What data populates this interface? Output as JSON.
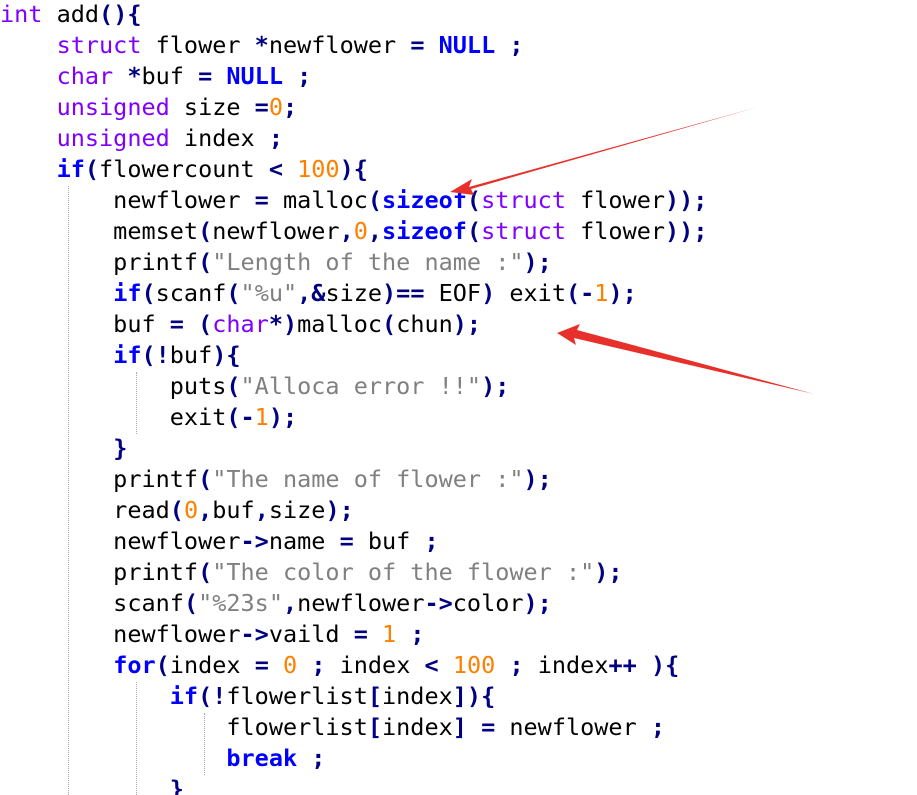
{
  "colors": {
    "plain": "#000000",
    "keyword": "#0000ff",
    "type": "#8000ff",
    "number": "#ff8000",
    "string": "#808080",
    "operator": "#000080",
    "annotation_arrow": "#e8302a",
    "guide": "#a8a8a8"
  },
  "code": {
    "lines": [
      [
        [
          "t",
          "int"
        ],
        [
          "p",
          " add"
        ],
        [
          "o",
          "(){"
        ]
      ],
      [
        [
          "p",
          "    "
        ],
        [
          "t",
          "struct"
        ],
        [
          "p",
          " flower "
        ],
        [
          "o",
          "*"
        ],
        [
          "p",
          "newflower "
        ],
        [
          "o",
          "="
        ],
        [
          "p",
          " "
        ],
        [
          "k",
          "NULL"
        ],
        [
          "p",
          " "
        ],
        [
          "o",
          ";"
        ]
      ],
      [
        [
          "p",
          "    "
        ],
        [
          "t",
          "char"
        ],
        [
          "p",
          " "
        ],
        [
          "o",
          "*"
        ],
        [
          "p",
          "buf "
        ],
        [
          "o",
          "="
        ],
        [
          "p",
          " "
        ],
        [
          "k",
          "NULL"
        ],
        [
          "p",
          " "
        ],
        [
          "o",
          ";"
        ]
      ],
      [
        [
          "p",
          "    "
        ],
        [
          "t",
          "unsigned"
        ],
        [
          "p",
          " size "
        ],
        [
          "o",
          "="
        ],
        [
          "n",
          "0"
        ],
        [
          "o",
          ";"
        ]
      ],
      [
        [
          "p",
          "    "
        ],
        [
          "t",
          "unsigned"
        ],
        [
          "p",
          " index "
        ],
        [
          "o",
          ";"
        ]
      ],
      [
        [
          "p",
          "    "
        ],
        [
          "k",
          "if"
        ],
        [
          "o",
          "("
        ],
        [
          "p",
          "flowercount "
        ],
        [
          "o",
          "<"
        ],
        [
          "p",
          " "
        ],
        [
          "n",
          "100"
        ],
        [
          "o",
          "){"
        ]
      ],
      [
        [
          "p",
          "        newflower "
        ],
        [
          "o",
          "="
        ],
        [
          "p",
          " malloc"
        ],
        [
          "o",
          "("
        ],
        [
          "k",
          "sizeof"
        ],
        [
          "o",
          "("
        ],
        [
          "t",
          "struct"
        ],
        [
          "p",
          " flower"
        ],
        [
          "o",
          "));"
        ]
      ],
      [
        [
          "p",
          "        memset"
        ],
        [
          "o",
          "("
        ],
        [
          "p",
          "newflower"
        ],
        [
          "o",
          ","
        ],
        [
          "n",
          "0"
        ],
        [
          "o",
          ","
        ],
        [
          "k",
          "sizeof"
        ],
        [
          "o",
          "("
        ],
        [
          "t",
          "struct"
        ],
        [
          "p",
          " flower"
        ],
        [
          "o",
          "));"
        ]
      ],
      [
        [
          "p",
          "        printf"
        ],
        [
          "o",
          "("
        ],
        [
          "s",
          "\"Length of the name :\""
        ],
        [
          "o",
          ");"
        ]
      ],
      [
        [
          "p",
          "        "
        ],
        [
          "k",
          "if"
        ],
        [
          "o",
          "("
        ],
        [
          "p",
          "scanf"
        ],
        [
          "o",
          "("
        ],
        [
          "s",
          "\"%u\""
        ],
        [
          "o",
          ",&"
        ],
        [
          "p",
          "size"
        ],
        [
          "o",
          ")=="
        ],
        [
          "p",
          " EOF"
        ],
        [
          "o",
          ")"
        ],
        [
          "p",
          " exit"
        ],
        [
          "o",
          "(-"
        ],
        [
          "n",
          "1"
        ],
        [
          "o",
          ");"
        ]
      ],
      [
        [
          "p",
          "        buf "
        ],
        [
          "o",
          "="
        ],
        [
          "p",
          " "
        ],
        [
          "o",
          "("
        ],
        [
          "t",
          "char"
        ],
        [
          "o",
          "*)"
        ],
        [
          "p",
          "malloc"
        ],
        [
          "o",
          "("
        ],
        [
          "p",
          "chun"
        ],
        [
          "o",
          ");"
        ]
      ],
      [
        [
          "p",
          "        "
        ],
        [
          "k",
          "if"
        ],
        [
          "o",
          "(!"
        ],
        [
          "p",
          "buf"
        ],
        [
          "o",
          ")"
        ],
        [
          "o",
          "{"
        ]
      ],
      [
        [
          "p",
          "            puts"
        ],
        [
          "o",
          "("
        ],
        [
          "s",
          "\"Alloca error !!\""
        ],
        [
          "o",
          ");"
        ]
      ],
      [
        [
          "p",
          "            exit"
        ],
        [
          "o",
          "(-"
        ],
        [
          "n",
          "1"
        ],
        [
          "o",
          ");"
        ]
      ],
      [
        [
          "p",
          "        "
        ],
        [
          "o",
          "}"
        ]
      ],
      [
        [
          "p",
          "        printf"
        ],
        [
          "o",
          "("
        ],
        [
          "s",
          "\"The name of flower :\""
        ],
        [
          "o",
          ");"
        ]
      ],
      [
        [
          "p",
          "        read"
        ],
        [
          "o",
          "("
        ],
        [
          "n",
          "0"
        ],
        [
          "o",
          ","
        ],
        [
          "p",
          "buf"
        ],
        [
          "o",
          ","
        ],
        [
          "p",
          "size"
        ],
        [
          "o",
          ");"
        ]
      ],
      [
        [
          "p",
          "        newflower"
        ],
        [
          "o",
          "->"
        ],
        [
          "p",
          "name "
        ],
        [
          "o",
          "="
        ],
        [
          "p",
          " buf "
        ],
        [
          "o",
          ";"
        ]
      ],
      [
        [
          "p",
          "        printf"
        ],
        [
          "o",
          "("
        ],
        [
          "s",
          "\"The color of the flower :\""
        ],
        [
          "o",
          ");"
        ]
      ],
      [
        [
          "p",
          "        scanf"
        ],
        [
          "o",
          "("
        ],
        [
          "s",
          "\"%23s\""
        ],
        [
          "o",
          ","
        ],
        [
          "p",
          "newflower"
        ],
        [
          "o",
          "->"
        ],
        [
          "p",
          "color"
        ],
        [
          "o",
          ");"
        ]
      ],
      [
        [
          "p",
          "        newflower"
        ],
        [
          "o",
          "->"
        ],
        [
          "p",
          "vaild "
        ],
        [
          "o",
          "="
        ],
        [
          "p",
          " "
        ],
        [
          "n",
          "1"
        ],
        [
          "p",
          " "
        ],
        [
          "o",
          ";"
        ]
      ],
      [
        [
          "p",
          "        "
        ],
        [
          "k",
          "for"
        ],
        [
          "o",
          "("
        ],
        [
          "p",
          "index "
        ],
        [
          "o",
          "="
        ],
        [
          "p",
          " "
        ],
        [
          "n",
          "0"
        ],
        [
          "p",
          " "
        ],
        [
          "o",
          ";"
        ],
        [
          "p",
          " index "
        ],
        [
          "o",
          "<"
        ],
        [
          "p",
          " "
        ],
        [
          "n",
          "100"
        ],
        [
          "p",
          " "
        ],
        [
          "o",
          ";"
        ],
        [
          "p",
          " index"
        ],
        [
          "o",
          "++"
        ],
        [
          "p",
          " "
        ],
        [
          "o",
          "){"
        ]
      ],
      [
        [
          "p",
          "            "
        ],
        [
          "k",
          "if"
        ],
        [
          "o",
          "(!"
        ],
        [
          "p",
          "flowerlist"
        ],
        [
          "o",
          "["
        ],
        [
          "p",
          "index"
        ],
        [
          "o",
          "])"
        ],
        [
          "o",
          "{"
        ]
      ],
      [
        [
          "p",
          "                flowerlist"
        ],
        [
          "o",
          "["
        ],
        [
          "p",
          "index"
        ],
        [
          "o",
          "]"
        ],
        [
          "p",
          " "
        ],
        [
          "o",
          "="
        ],
        [
          "p",
          " newflower "
        ],
        [
          "o",
          ";"
        ]
      ],
      [
        [
          "p",
          "                "
        ],
        [
          "k",
          "break"
        ],
        [
          "p",
          " "
        ],
        [
          "o",
          ";"
        ]
      ],
      [
        [
          "p",
          "            "
        ],
        [
          "o",
          "}"
        ]
      ]
    ]
  }
}
